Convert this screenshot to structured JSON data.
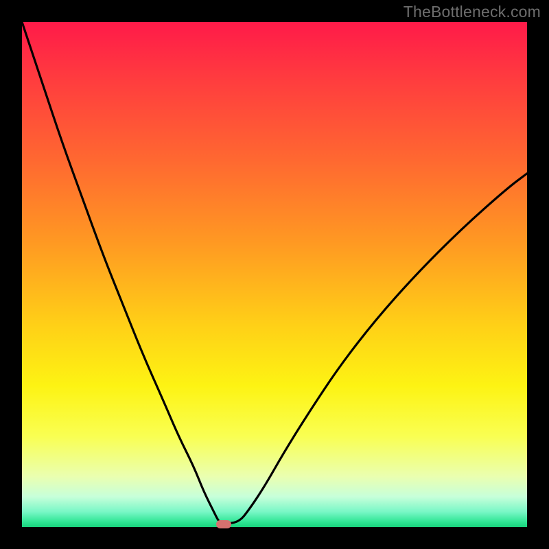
{
  "watermark": "TheBottleneck.com",
  "chart_data": {
    "type": "line",
    "title": "",
    "xlabel": "",
    "ylabel": "",
    "xlim": [
      0,
      100
    ],
    "ylim": [
      0,
      100
    ],
    "grid": false,
    "legend": false,
    "marker": {
      "x": 40,
      "y": 0.6,
      "color": "#d6716f"
    },
    "series": [
      {
        "name": "bottleneck-curve",
        "x": [
          0,
          4,
          8,
          12,
          16,
          20,
          24,
          28,
          31,
          34,
          36,
          38,
          39,
          40,
          43,
          45,
          48,
          52,
          57,
          63,
          70,
          78,
          87,
          96,
          100
        ],
        "y": [
          100,
          88,
          76,
          65,
          54,
          44,
          34,
          25,
          18,
          12,
          7,
          3,
          1,
          0.6,
          1,
          3.5,
          8,
          15,
          23,
          32,
          41,
          50,
          59,
          67,
          70
        ]
      }
    ],
    "background_gradient": {
      "direction": "vertical",
      "stops": [
        {
          "pos": 0.0,
          "color": "#ff1a49"
        },
        {
          "pos": 0.12,
          "color": "#ff3e3e"
        },
        {
          "pos": 0.28,
          "color": "#ff6a30"
        },
        {
          "pos": 0.44,
          "color": "#ff9a22"
        },
        {
          "pos": 0.6,
          "color": "#ffd017"
        },
        {
          "pos": 0.72,
          "color": "#fdf313"
        },
        {
          "pos": 0.82,
          "color": "#f9ff52"
        },
        {
          "pos": 0.9,
          "color": "#eaffb0"
        },
        {
          "pos": 0.94,
          "color": "#c7ffda"
        },
        {
          "pos": 0.97,
          "color": "#78f7c6"
        },
        {
          "pos": 0.99,
          "color": "#2fe594"
        },
        {
          "pos": 1.0,
          "color": "#18d27c"
        }
      ]
    }
  }
}
